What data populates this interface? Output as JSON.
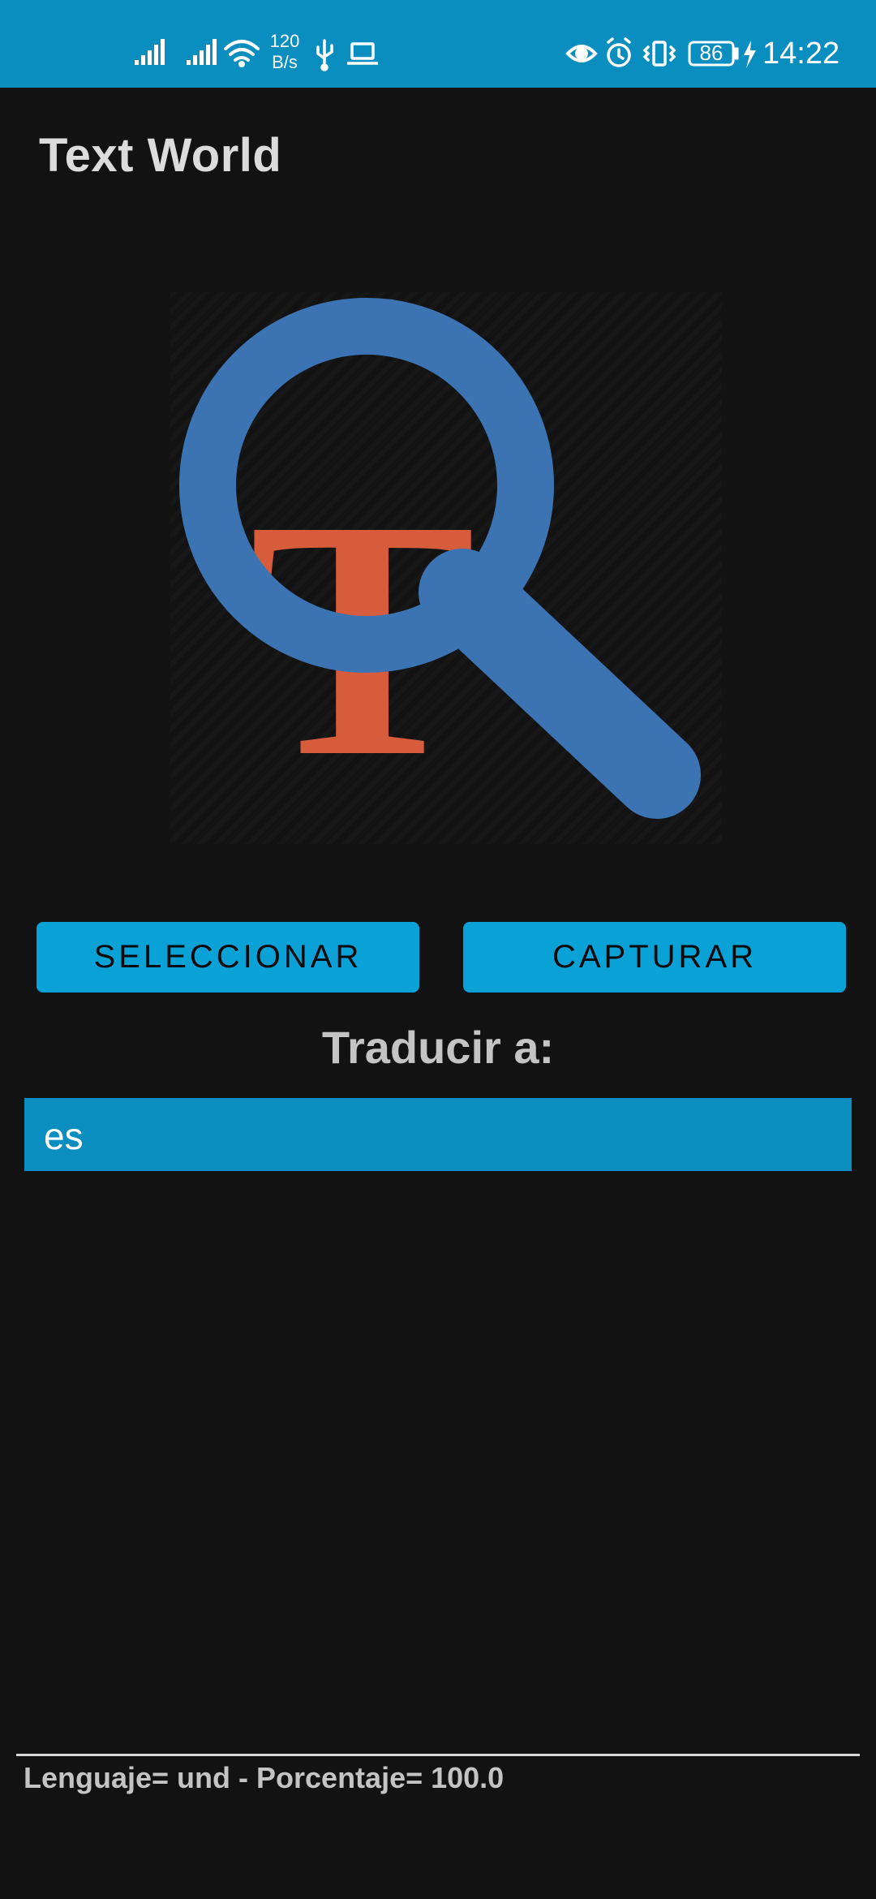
{
  "status_bar": {
    "network_speed_value": "120",
    "network_speed_unit": "B/s",
    "battery_level": "86",
    "time": "14:22",
    "background_color": "#0a8dbf",
    "icons": [
      "signal-icon",
      "signal-icon",
      "wifi-icon",
      "usb-icon",
      "laptop-icon",
      "eye-icon",
      "alarm-icon",
      "vibrate-icon",
      "battery-icon",
      "charging-icon"
    ]
  },
  "app": {
    "title": "Text World",
    "logo_letter": "T",
    "logo_colors": {
      "magnifier": "#3b73b3",
      "letter": "#d65c3b"
    }
  },
  "buttons": {
    "select_label": "SELECCIONAR",
    "capture_label": "CAPTURAR",
    "color": "#0aa1d6"
  },
  "translate": {
    "label": "Traducir a:",
    "selected_language": "es"
  },
  "footer": {
    "status_text": "Lenguaje= und - Porcentaje= 100.0"
  }
}
